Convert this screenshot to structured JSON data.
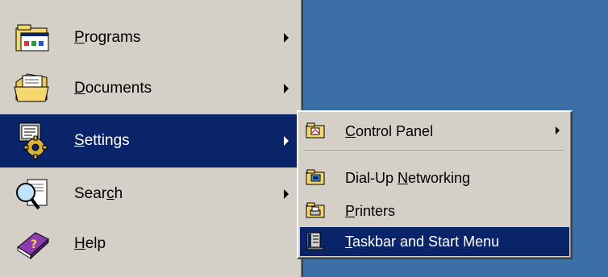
{
  "start_menu": {
    "items": [
      {
        "pre": "",
        "key": "P",
        "post": "rograms",
        "icon": "programs-icon",
        "has_arrow": true
      },
      {
        "pre": "",
        "key": "D",
        "post": "ocuments",
        "icon": "documents-icon",
        "has_arrow": true
      },
      {
        "pre": "",
        "key": "S",
        "post": "ettings",
        "icon": "settings-icon",
        "has_arrow": true,
        "highlighted": true
      },
      {
        "pre": "Sear",
        "key": "c",
        "post": "h",
        "icon": "search-icon",
        "has_arrow": true
      },
      {
        "pre": "",
        "key": "H",
        "post": "elp",
        "icon": "help-icon",
        "has_arrow": false
      }
    ]
  },
  "settings_submenu": {
    "items": [
      {
        "pre": "",
        "key": "C",
        "post": "ontrol Panel",
        "icon": "control-panel-folder-icon",
        "has_arrow": true
      },
      {
        "pre": "Dial-Up ",
        "key": "N",
        "post": "etworking",
        "icon": "dialup-networking-folder-icon",
        "has_arrow": false
      },
      {
        "pre": "",
        "key": "P",
        "post": "rinters",
        "icon": "printers-folder-icon",
        "has_arrow": false
      },
      {
        "pre": "",
        "key": "T",
        "post": "askbar and Start Menu",
        "icon": "taskbar-icon",
        "has_arrow": false,
        "highlighted": true
      }
    ]
  },
  "colors": {
    "desktop": "#3a6ea5",
    "menu_face": "#d4d0c8",
    "highlight": "#0a246a",
    "highlight_text": "#ffffff"
  }
}
